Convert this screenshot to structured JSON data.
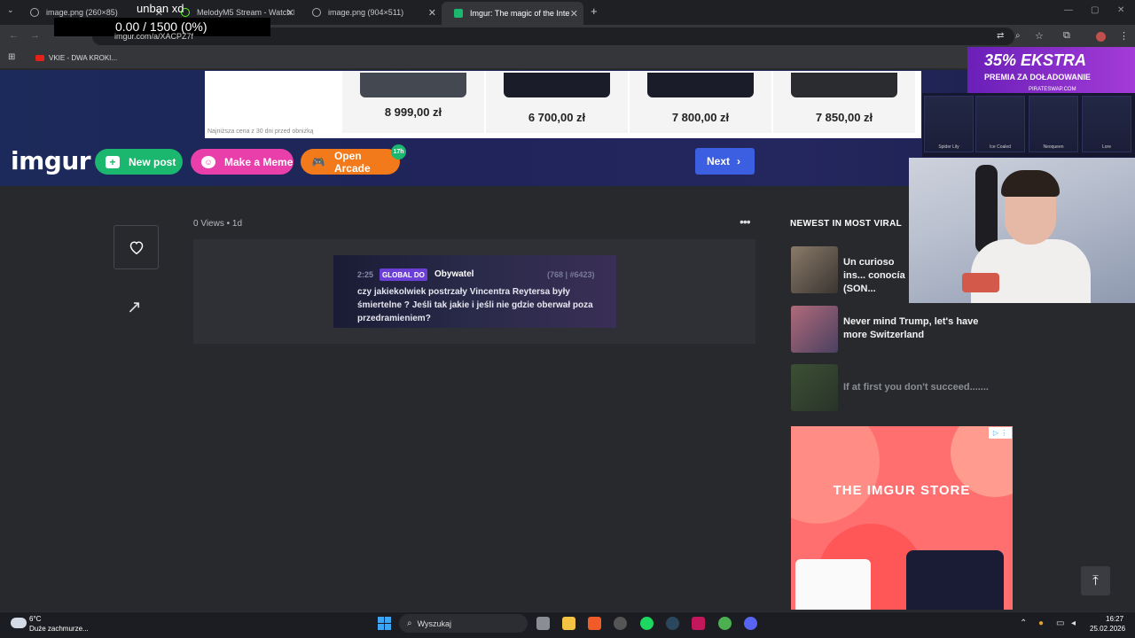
{
  "browser": {
    "tabs": [
      {
        "title": "image.png (260×85)"
      },
      {
        "title": "MelodyM5 Stream - Watch Live ..."
      },
      {
        "title": "image.png (904×511)"
      },
      {
        "title": "Imgur: The magic of the Internet"
      }
    ],
    "new_tab": "+",
    "url": "imgur.com/a/XACPZ7f",
    "bookmark": "VKIE - DWA KROKI..."
  },
  "overlay": {
    "name": "unban xd",
    "counter": "0.00 / 1500 (0%)"
  },
  "shop_ad": {
    "prices": [
      "8 999,00 zł",
      "6 700,00 zł",
      "7 800,00 zł",
      "7 850,00 zł"
    ],
    "note": "Najniższa cena z 30 dni przed obniżką"
  },
  "promo_ad": {
    "title": "35% EKSTRA",
    "subtitle": "PREMIA ZA DOŁADOWANIE",
    "brand": "PIRATESWAP.COM",
    "skins": [
      "Spider Lily",
      "Ice Coaled",
      "Neoqueen",
      "Lore"
    ]
  },
  "imgur": {
    "logo": "imgur",
    "new_post": "New post",
    "make_meme": "Make a Meme",
    "open_arcade": "Open Arcade",
    "arcade_badge": "17h",
    "next": "Next"
  },
  "post": {
    "views": "0 Views • 1d",
    "chat": {
      "time": "2:25",
      "tag": "GLOBAL DO",
      "user": "Obywatel",
      "stats": "(768 | #6423)",
      "message": "czy jakiekolwiek postrzały Vincentra Reytersa były śmiertelne ? Jeśli tak jakie i jeśli nie gdzie oberwał poza przedramieniem?"
    }
  },
  "sidebar": {
    "title": "NEWEST IN MOST VIRAL",
    "items": [
      {
        "title": "Un curioso ins... conocía (SON..."
      },
      {
        "title": "Never mind Trump, let's have more Switzerland"
      },
      {
        "title": "If at first you don't succeed......."
      }
    ]
  },
  "store_ad": {
    "title": "THE IMGUR STORE"
  },
  "taskbar": {
    "weather_temp": "6°C",
    "weather_desc": "Duże zachmurze...",
    "search": "Wyszukaj",
    "time": "16:27",
    "date": "25.02.2026"
  },
  "colors": {
    "accent_green": "#1bb76e",
    "accent_pink": "#e93fab",
    "accent_orange": "#f27a1a",
    "accent_blue": "#3b5fe0"
  }
}
